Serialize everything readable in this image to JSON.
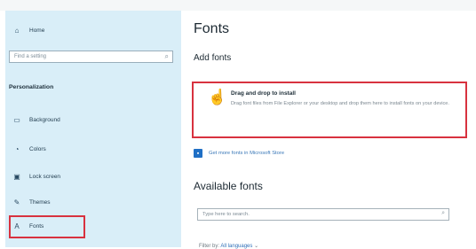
{
  "sidebar": {
    "home_label": "Home",
    "search_placeholder": "Find a setting",
    "section_title": "Personalization",
    "items": [
      {
        "label": "Background",
        "icon": "image-icon"
      },
      {
        "label": "Colors",
        "icon": "palette-icon"
      },
      {
        "label": "Lock screen",
        "icon": "lock-screen-icon"
      },
      {
        "label": "Themes",
        "icon": "brush-icon"
      },
      {
        "label": "Fonts",
        "icon": "fonts-icon"
      }
    ]
  },
  "main": {
    "title": "Fonts",
    "add_fonts_title": "Add fonts",
    "drop_zone": {
      "title": "Drag and drop to install",
      "description": "Drag font files from File Explorer or your desktop and drop them here to install fonts on your device."
    },
    "store_link": "Get more fonts in Microsoft Store",
    "available_title": "Available fonts",
    "font_search_placeholder": "Type here to search.",
    "filter_label": "Filter by:",
    "filter_value": "All languages"
  },
  "colors": {
    "sidebar_bg": "#d9eef8",
    "highlight": "#d8323f",
    "link": "#3a78b8"
  }
}
